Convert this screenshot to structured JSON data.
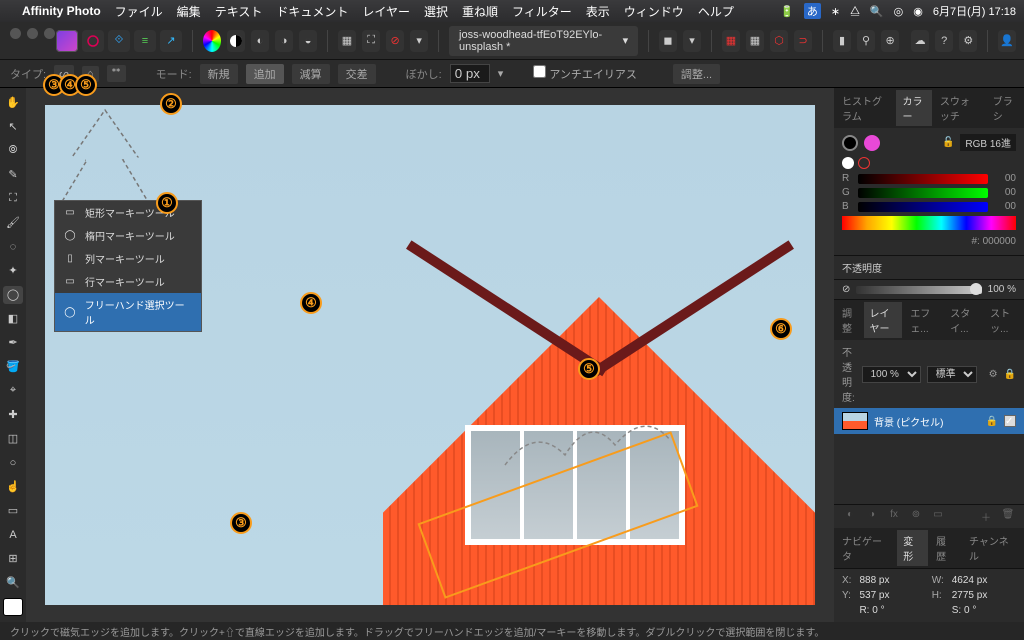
{
  "menubar": {
    "app": "Affinity Photo",
    "items": [
      "ファイル",
      "編集",
      "テキスト",
      "ドキュメント",
      "レイヤー",
      "選択",
      "重ね順",
      "フィルター",
      "表示",
      "ウィンドウ",
      "ヘルプ"
    ],
    "clock": "6月7日(月) 17:18"
  },
  "doc_tab": "joss-woodhead-tfEoT92EYlo-unsplash *",
  "contextbar": {
    "type_label": "タイプ:",
    "mode_label": "モード:",
    "modes": [
      "新規",
      "追加",
      "減算",
      "交差"
    ],
    "blur_label": "ぼかし:",
    "blur_value": "0 px",
    "antialias": "アンチエイリアス",
    "adjust": "調整..."
  },
  "flyout": {
    "items": [
      "矩形マーキーツール",
      "楕円マーキーツール",
      "列マーキーツール",
      "行マーキーツール",
      "フリーハンド選択ツール"
    ],
    "selected": 4
  },
  "annotations": [
    "①",
    "②",
    "③",
    "④",
    "⑤",
    "⑥"
  ],
  "panels": {
    "color_tabs": [
      "ヒストグラム",
      "カラー",
      "スウォッチ",
      "ブラシ"
    ],
    "color_mode": "RGB 16進",
    "r": "00",
    "g": "00",
    "b": "00",
    "hex": "#: 000000",
    "opacity_label": "不透明度",
    "opacity_val": "100 %",
    "layer_tabs": [
      "調整",
      "レイヤー",
      "エフェ...",
      "スタイ...",
      "ストッ..."
    ],
    "opacity2_label": "不透明度:",
    "opacity2_val": "100 %",
    "blend": "標準",
    "layer_name": "背景 (ピクセル)",
    "nav_tabs": [
      "ナビゲータ",
      "変形",
      "履歴",
      "チャンネル"
    ],
    "transform": {
      "x": "888 px",
      "y": "537 px",
      "w": "4624 px",
      "h": "2775 px",
      "r": "R: 0 °",
      "s": "S: 0 °"
    }
  },
  "status": "クリックで磁気エッジを追加します。クリック+⇧で直線エッジを追加します。ドラッグでフリーハンドエッジを追加/マーキーを移動します。ダブルクリックで選択範囲を閉じます。"
}
